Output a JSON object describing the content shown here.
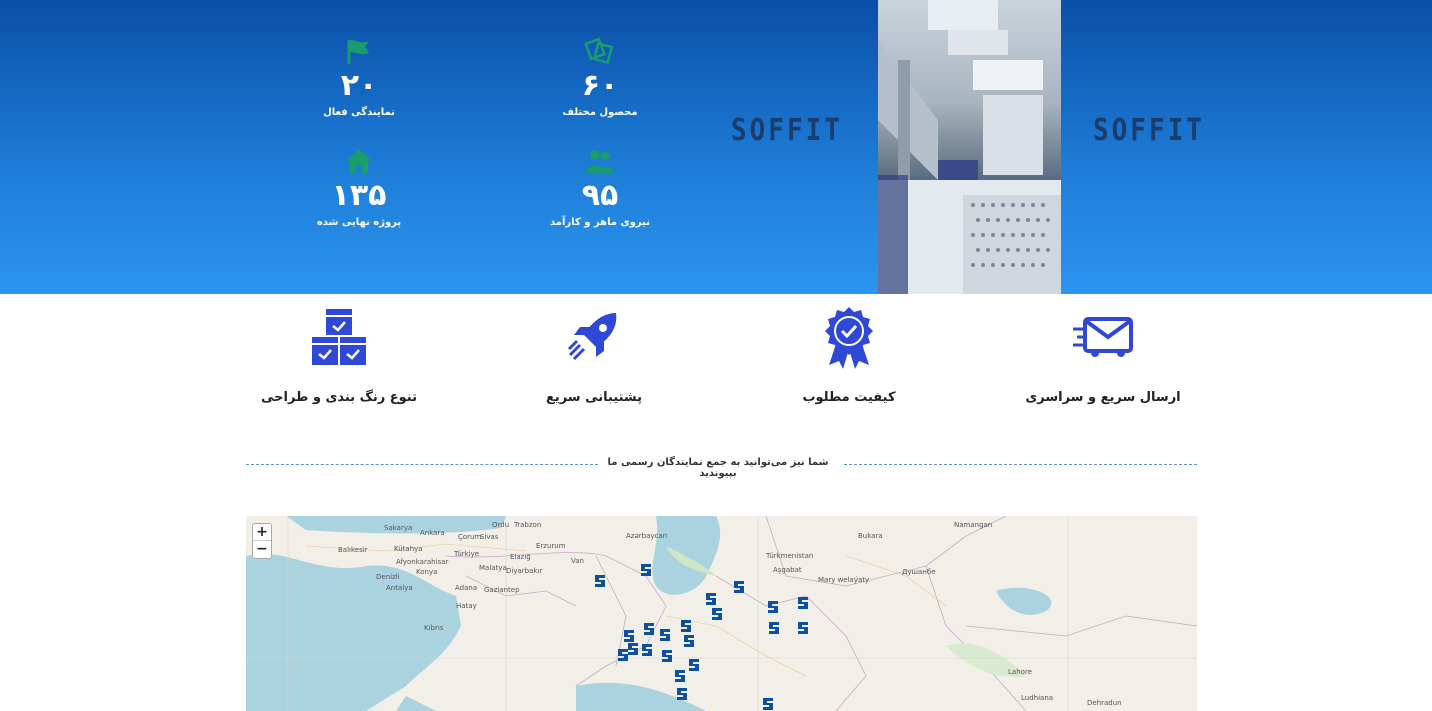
{
  "hero": {
    "stats": [
      {
        "icon": "flag-icon",
        "value": "۲۰",
        "label": "نمایندگی فعال"
      },
      {
        "icon": "product-icon",
        "value": "۶۰",
        "label": "محصول مختلف"
      },
      {
        "icon": "home-icon",
        "value": "۱۳۵",
        "label": "پروژه نهایی شده"
      },
      {
        "icon": "team-icon",
        "value": "۹۵",
        "label": "نیروی ماهر و کارآمد"
      }
    ],
    "logo_text": "SOFFIT",
    "accent_color": "#1a9c6c"
  },
  "features": [
    {
      "icon": "boxes-icon",
      "label": "تنوع رنگ بندی و طراحی"
    },
    {
      "icon": "rocket-icon",
      "label": "پشتیبانی سریع"
    },
    {
      "icon": "quality-badge-icon",
      "label": "کیفیت مطلوب"
    },
    {
      "icon": "delivery-icon",
      "label": "ارسال سریع و سراسری"
    }
  ],
  "divider_text": "شما نیز می‌توانید به جمع نمایندگان رسمی ما بپیوندید",
  "map": {
    "zoom_in": "+",
    "zoom_out": "−",
    "labels": [
      "Sakarya",
      "Ankara",
      "Çorum",
      "Sivas",
      "Ordu",
      "Trabzon",
      "Erzurum",
      "Azərbaycan",
      "Bukara",
      "Namangan",
      "Türkiye",
      "Konya",
      "Adana",
      "Malatya",
      "Diyarbakır",
      "Elazığ",
      "Van",
      "Türkmenistan",
      "Aşgabat",
      "Mary welaýaty",
      "Душанбе",
      "Kıbrıs",
      "Antalya",
      "Denizli",
      "Balıkesir",
      "Kütahya",
      "Afyonkarahisar",
      "Hatay",
      "Gaziantep",
      "Ludhiana",
      "Dehradun",
      "Lahore"
    ],
    "marker_count": 22,
    "marker_color": "#0d4fa0"
  }
}
